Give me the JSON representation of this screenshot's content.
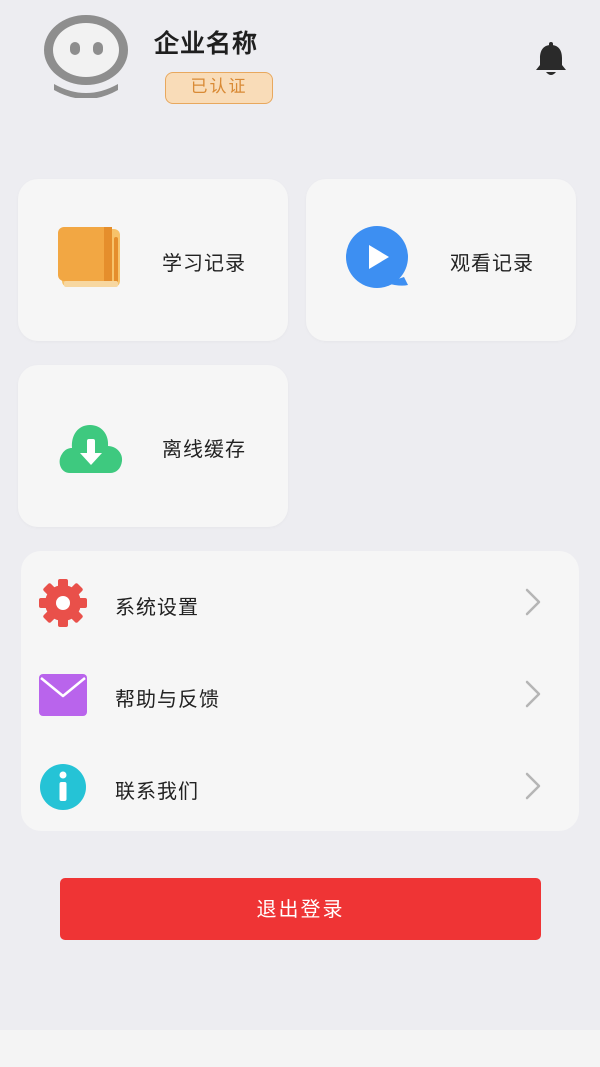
{
  "header": {
    "company_name": "企业名称",
    "verified_badge": "已认证"
  },
  "cards": {
    "study_records": "学习记录",
    "watch_records": "观看记录",
    "offline_cache": "离线缓存"
  },
  "menu": {
    "items": [
      {
        "label": "系统设置",
        "icon": "gear-icon"
      },
      {
        "label": "帮助与反馈",
        "icon": "mail-icon"
      },
      {
        "label": "联系我们",
        "icon": "info-icon"
      }
    ]
  },
  "logout_label": "退出登录",
  "colors": {
    "logout": "#ef3435",
    "badge_bg": "#f9dcb8",
    "badge_text": "#d98a35",
    "book_orange": "#f2a743",
    "play_blue": "#3d8ff2",
    "cloud_green": "#3ec97f",
    "gear_red": "#e9504a",
    "mail_purple": "#b964ec",
    "info_cyan": "#25c3d6"
  }
}
